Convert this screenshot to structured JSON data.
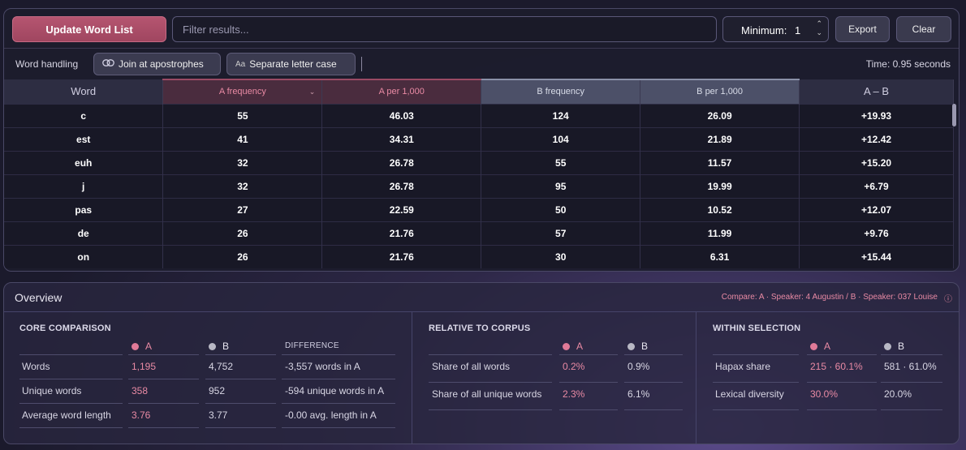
{
  "toolbar": {
    "update_label": "Update Word List",
    "filter_placeholder": "Filter results...",
    "minimum_label": "Minimum:",
    "minimum_value": "1",
    "export_label": "Export",
    "clear_label": "Clear"
  },
  "subbar": {
    "word_handling_label": "Word handling",
    "join_label": "Join at apostrophes",
    "case_label": "Separate letter case",
    "case_icon_text": "Aa",
    "time_label": "Time: 0.95 seconds"
  },
  "table": {
    "headers": [
      "Word",
      "A frequency",
      "A per 1,000",
      "B frequency",
      "B per 1,000",
      "A – B"
    ],
    "rows": [
      [
        "c",
        "55",
        "46.03",
        "124",
        "26.09",
        "+19.93"
      ],
      [
        "est",
        "41",
        "34.31",
        "104",
        "21.89",
        "+12.42"
      ],
      [
        "euh",
        "32",
        "26.78",
        "55",
        "11.57",
        "+15.20"
      ],
      [
        "j",
        "32",
        "26.78",
        "95",
        "19.99",
        "+6.79"
      ],
      [
        "pas",
        "27",
        "22.59",
        "50",
        "10.52",
        "+12.07"
      ],
      [
        "de",
        "26",
        "21.76",
        "57",
        "11.99",
        "+9.76"
      ],
      [
        "on",
        "26",
        "21.76",
        "30",
        "6.31",
        "+15.44"
      ]
    ]
  },
  "overview": {
    "title": "Overview",
    "compare": "Compare: A · Speaker: 4 Augustin / B · Speaker: 037 Louise",
    "core": {
      "title": "CORE COMPARISON",
      "col_a": "A",
      "col_b": "B",
      "col_diff": "DIFFERENCE",
      "rows": [
        {
          "label": "Words",
          "a": "1,195",
          "b": "4,752",
          "diff": "-3,557 words in A"
        },
        {
          "label": "Unique words",
          "a": "358",
          "b": "952",
          "diff": "-594 unique words in A"
        },
        {
          "label": "Average word length",
          "a": "3.76",
          "b": "3.77",
          "diff": "-0.00 avg. length in A"
        }
      ]
    },
    "relative": {
      "title": "RELATIVE TO CORPUS",
      "col_a": "A",
      "col_b": "B",
      "rows": [
        {
          "label": "Share of all words",
          "a": "0.2%",
          "b": "0.9%"
        },
        {
          "label": "Share of all unique words",
          "a": "2.3%",
          "b": "6.1%"
        }
      ]
    },
    "within": {
      "title": "WITHIN SELECTION",
      "col_a": "A",
      "col_b": "B",
      "rows": [
        {
          "label": "Hapax share",
          "a": "215 · 60.1%",
          "b": "581 · 61.0%"
        },
        {
          "label": "Lexical diversity",
          "a": "30.0%",
          "b": "20.0%"
        }
      ]
    }
  },
  "colors": {
    "accent_a": "#e07a98",
    "accent_b": "#b8b8c4",
    "update_button": "#a84a66"
  },
  "icons": {
    "join": "link-icon",
    "case": "letter-case-icon",
    "sort": "chevron-down-icon",
    "info": "info-icon",
    "spinner": "stepper-icon"
  }
}
